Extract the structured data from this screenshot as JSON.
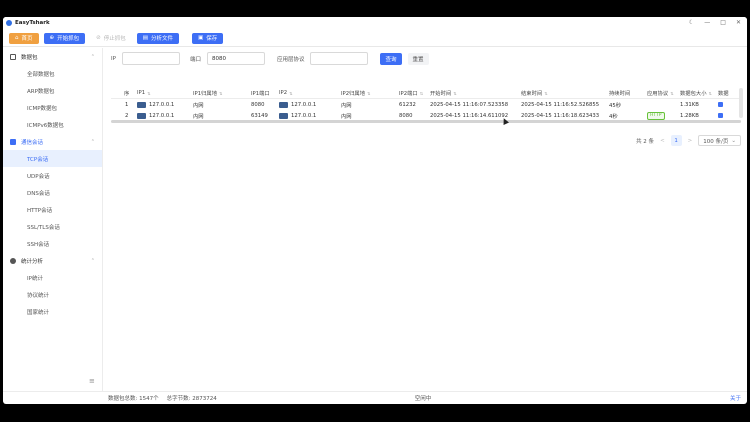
{
  "app": {
    "title": "EasyTshark",
    "controls": {
      "theme": "☾",
      "minimize": "—",
      "maximize": "□",
      "close": "✕"
    }
  },
  "toolbar": {
    "home": "首页",
    "start_capture": "开始抓包",
    "stop_capture": "停止抓包",
    "analyze_file": "分析文件",
    "save": "保存"
  },
  "sidebar": {
    "groups": [
      {
        "label": "数据包",
        "items": [
          "全部数据包",
          "ARP数据包",
          "ICMP数据包",
          "ICMPv6数据包"
        ]
      },
      {
        "label": "通信会话",
        "items": [
          "TCP会话",
          "UDP会话",
          "DNS会话",
          "HTTP会话",
          "SSL/TLS会话",
          "SSH会话"
        ]
      },
      {
        "label": "统计分析",
        "items": [
          "IP统计",
          "协议统计",
          "国家统计"
        ]
      }
    ],
    "active_item": "TCP会话"
  },
  "filter": {
    "ip_label": "IP",
    "ip_value": "",
    "port_label": "端口",
    "port_value": "8080",
    "proto_label": "应用层协议",
    "proto_value": "",
    "search_btn": "查询",
    "reset_btn": "重置"
  },
  "table": {
    "columns": [
      "序号",
      "IP1",
      "IP1归属地",
      "IP1端口",
      "IP2",
      "IP2归属地",
      "IP2端口",
      "开始时间",
      "结束时间",
      "持续时间",
      "应用协议",
      "数据包大小",
      "数据"
    ],
    "rows": [
      {
        "no": "1",
        "ip1": "127.0.0.1",
        "loc1": "内网",
        "port1": "8080",
        "ip2": "127.0.0.1",
        "loc2": "内网",
        "port2": "61232",
        "start": "2025-04-15 11:16:07.523358",
        "end": "2025-04-15 11:16:52.526855",
        "dur": "45秒",
        "proto": "",
        "size": "1.31KB"
      },
      {
        "no": "2",
        "ip1": "127.0.0.1",
        "loc1": "内网",
        "port1": "63149",
        "ip2": "127.0.0.1",
        "loc2": "内网",
        "port2": "8080",
        "start": "2025-04-15 11:16:14.611092",
        "end": "2025-04-15 11:16:18.623433",
        "dur": "4秒",
        "proto": "HTTP",
        "size": "1.28KB"
      }
    ]
  },
  "pager": {
    "total": "共 2 条",
    "prev": "<",
    "page": "1",
    "next": ">",
    "page_size": "100 条/页"
  },
  "status": {
    "packet_count": "数据包总数: 1547个",
    "byte_count": "总字节数: 2873724",
    "state": "空闲中",
    "about": "关于"
  },
  "colors": {
    "primary": "#3d6ef5",
    "orange": "#f0a040",
    "http_tag": "#67c23a"
  }
}
